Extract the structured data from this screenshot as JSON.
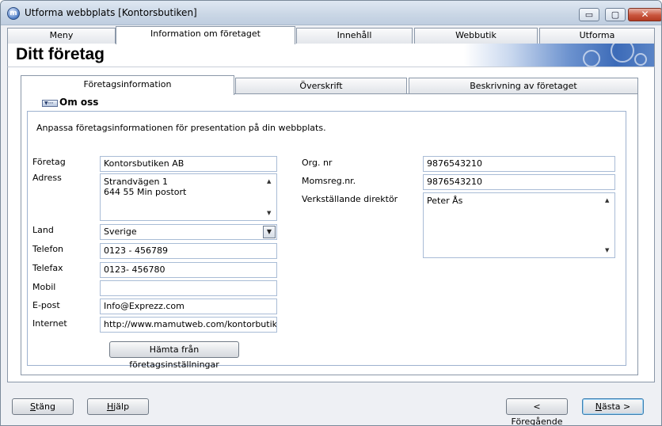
{
  "window": {
    "title": "Utforma webbplats [Kontorsbutiken]",
    "controls": {
      "minimize": "▭",
      "maximize": "▢",
      "close": "✕"
    }
  },
  "nav_tabs": [
    {
      "label": "Meny",
      "active": false
    },
    {
      "label": "Information om företaget",
      "active": true
    },
    {
      "label": "Innehåll",
      "active": false
    },
    {
      "label": "Webbutik",
      "active": false
    },
    {
      "label": "Utforma",
      "active": false
    }
  ],
  "header": {
    "title": "Ditt företag"
  },
  "sub_tabs": [
    {
      "label": "Företagsinformation",
      "active": true
    },
    {
      "label": "Överskrift",
      "active": false
    },
    {
      "label": "Beskrivning av företaget",
      "active": false
    }
  ],
  "section": {
    "title": "Om oss",
    "intro": "Anpassa företagsinformationen för presentation på din webbplats."
  },
  "form_left": {
    "company": {
      "label": "Företag",
      "value": "Kontorsbutiken AB"
    },
    "address": {
      "label": "Adress",
      "line1": "Strandvägen 1",
      "line2": "644 55 Min postort"
    },
    "country": {
      "label": "Land",
      "value": "Sverige"
    },
    "phone": {
      "label": "Telefon",
      "value": "0123 - 456789"
    },
    "fax": {
      "label": "Telefax",
      "value": "0123- 456780"
    },
    "mobile": {
      "label": "Mobil",
      "value": ""
    },
    "email": {
      "label": "E-post",
      "value": "Info@Exprezz.com"
    },
    "internet": {
      "label": "Internet",
      "value": "http://www.mamutweb.com/kontorbutiken"
    },
    "fetch_button": "Hämta från företagsinställningar"
  },
  "form_right": {
    "org_nr": {
      "label": "Org. nr",
      "value": "9876543210"
    },
    "vat_nr": {
      "label": "Momsreg.nr.",
      "value": "9876543210"
    },
    "ceo": {
      "label": "Verkställande direktör",
      "value": "Peter Ås"
    }
  },
  "footer": {
    "close_button": {
      "mnemonic": "S",
      "rest": "täng"
    },
    "help_button": {
      "mnemonic": "H",
      "rest": "jälp"
    },
    "prev_button": {
      "prefix": "< ",
      "mnemonic": "F",
      "rest": "öregående"
    },
    "next_button": {
      "mnemonic": "N",
      "rest": "ästa >"
    }
  },
  "colors": {
    "accent": "#3c6bb8",
    "field_border": "#a9bcd6",
    "group_border": "#9db1cf"
  }
}
